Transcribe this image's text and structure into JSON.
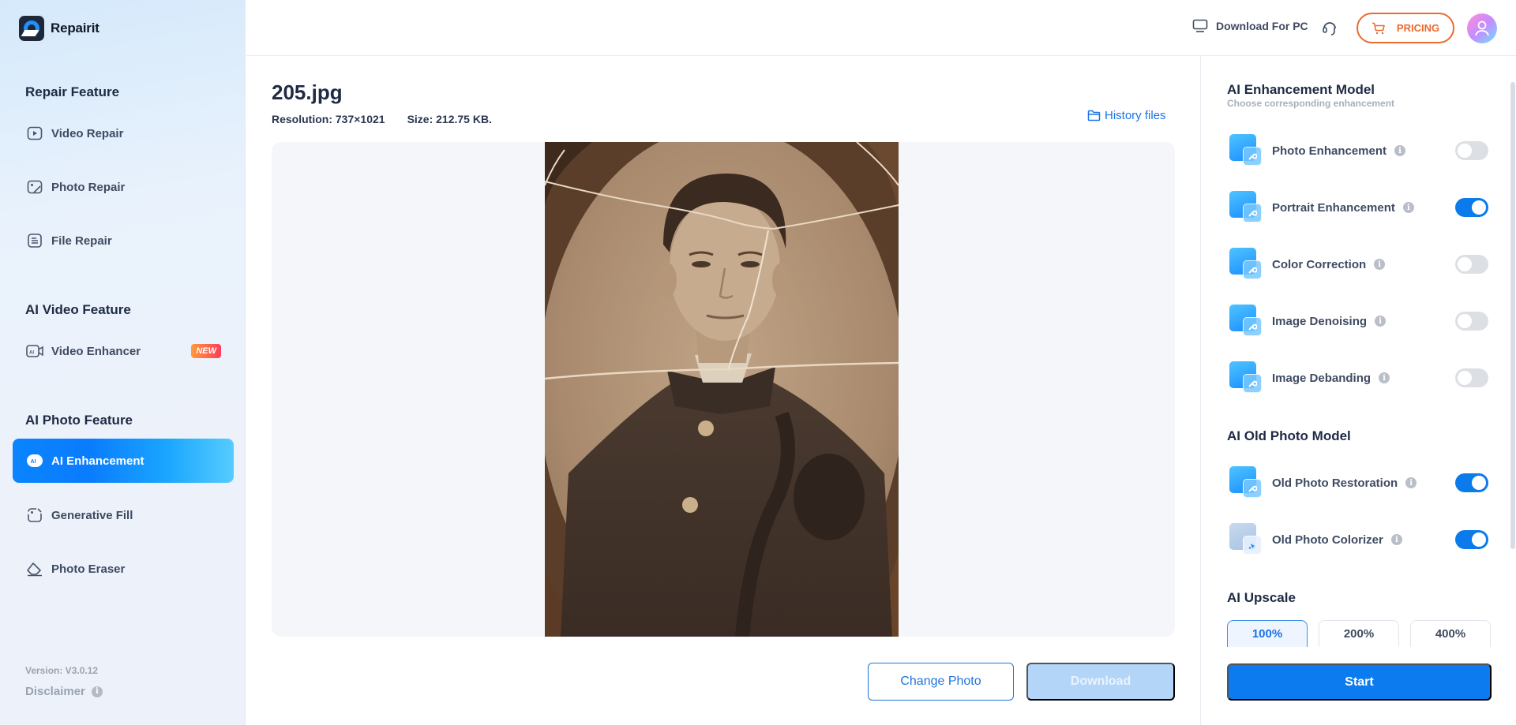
{
  "app": {
    "name": "Repairit"
  },
  "sidebar": {
    "sections": [
      {
        "title": "Repair Feature",
        "items": [
          {
            "label": "Video Repair",
            "icon": "video-play-icon"
          },
          {
            "label": "Photo Repair",
            "icon": "photo-icon"
          },
          {
            "label": "File Repair",
            "icon": "file-icon"
          }
        ]
      },
      {
        "title": "AI Video Feature",
        "items": [
          {
            "label": "Video Enhancer",
            "icon": "ai-video-icon",
            "badge": "NEW"
          }
        ]
      },
      {
        "title": "AI Photo Feature",
        "items": [
          {
            "label": "AI Enhancement",
            "icon": "ai-badge-icon",
            "active": true
          },
          {
            "label": "Generative Fill",
            "icon": "generative-fill-icon"
          },
          {
            "label": "Photo Eraser",
            "icon": "eraser-icon"
          }
        ]
      }
    ],
    "version": "Version: V3.0.12",
    "disclaimer": "Disclaimer"
  },
  "header": {
    "download_pc": "Download For PC",
    "pricing": "PRICING"
  },
  "main": {
    "file_name": "205.jpg",
    "resolution": "Resolution: 737×1021",
    "size": "Size: 212.75 KB.",
    "history": "History files",
    "change_photo": "Change Photo",
    "download": "Download"
  },
  "panel": {
    "enhancement": {
      "title": "AI Enhancement Model",
      "subtitle": "Choose corresponding enhancement",
      "options": [
        {
          "label": "Photo Enhancement",
          "enabled": false
        },
        {
          "label": "Portrait Enhancement",
          "enabled": true
        },
        {
          "label": "Color Correction",
          "enabled": false
        },
        {
          "label": "Image Denoising",
          "enabled": false
        },
        {
          "label": "Image Debanding",
          "enabled": false
        }
      ]
    },
    "old_photo": {
      "title": "AI Old Photo Model",
      "options": [
        {
          "label": "Old Photo Restoration",
          "enabled": true
        },
        {
          "label": "Old Photo Colorizer",
          "enabled": true
        }
      ]
    },
    "upscale": {
      "title": "AI Upscale",
      "options": [
        "100%",
        "200%",
        "400%"
      ],
      "selected": "100%"
    },
    "start": "Start"
  },
  "colors": {
    "accent": "#0b7bef",
    "pricing": "#ec6a2c",
    "new_badge": "#ff3d5a"
  }
}
